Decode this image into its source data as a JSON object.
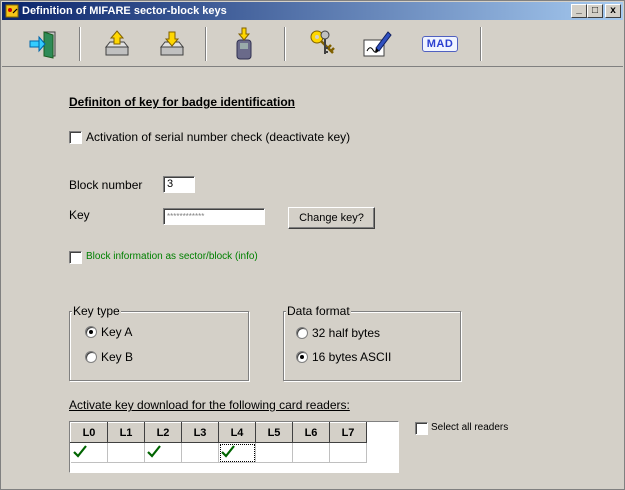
{
  "window": {
    "title": "Definition of MIFARE sector-block keys",
    "minimize_glyph": "_",
    "maximize_glyph": "□",
    "close_glyph": "x"
  },
  "toolbar": {
    "buttons": [
      {
        "name": "exit-icon"
      },
      {
        "name": "upload-icon"
      },
      {
        "name": "download-icon"
      },
      {
        "name": "download-to-device-icon"
      },
      {
        "name": "keys-icon"
      },
      {
        "name": "sign-icon"
      },
      {
        "name": "mad-icon",
        "label": "MAD"
      }
    ]
  },
  "main": {
    "heading": "Definiton of key for badge identification",
    "serial_check": {
      "label": "Activation of serial number check (deactivate key)",
      "checked": false
    },
    "block_number": {
      "label": "Block number",
      "value": "3"
    },
    "key": {
      "label": "Key",
      "value": "************"
    },
    "change_key_button": "Change key?",
    "block_info": {
      "label": "Block information as sector/block (info)",
      "checked": false
    },
    "key_type": {
      "title": "Key type",
      "options": [
        {
          "label": "Key A",
          "selected": true
        },
        {
          "label": "Key B",
          "selected": false
        }
      ]
    },
    "data_format": {
      "title": "Data format",
      "options": [
        {
          "label": "32 half bytes",
          "selected": false
        },
        {
          "label": "16 bytes ASCII",
          "selected": true
        }
      ]
    },
    "readers_section_label": "Activate key download for the following card readers:",
    "readers": {
      "columns": [
        "L0",
        "L1",
        "L2",
        "L3",
        "L4",
        "L5",
        "L6",
        "L7"
      ],
      "checked": [
        true,
        false,
        true,
        false,
        true,
        false,
        false,
        false
      ]
    },
    "select_all": {
      "label": "Select all readers",
      "checked": false
    }
  },
  "colors": {
    "titlebar_start": "#0a246a",
    "titlebar_end": "#a6caf0",
    "window_bg": "#d4d0c8",
    "info_text": "#008000",
    "check_mark": "#006400"
  }
}
